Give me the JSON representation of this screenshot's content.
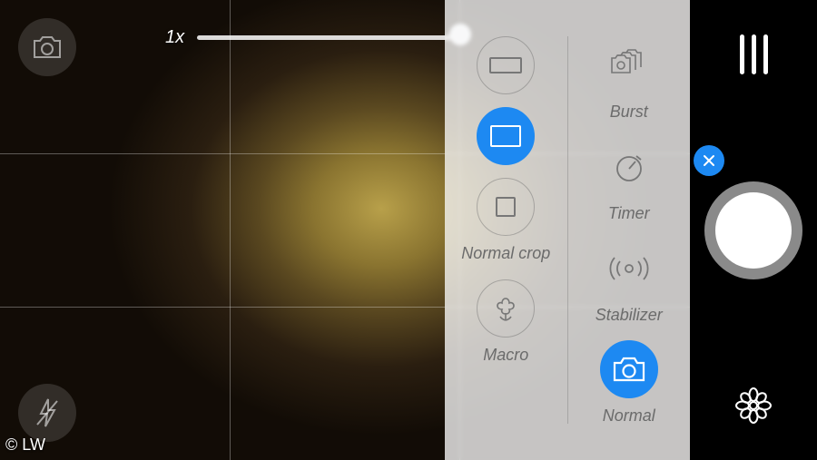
{
  "zoom": {
    "label": "1x"
  },
  "cropOptions": {
    "wide": "",
    "normal": "",
    "crop_label": "Normal crop",
    "macro_label": "Macro"
  },
  "modeOptions": {
    "burst": "Burst",
    "timer": "Timer",
    "stabilizer": "Stabilizer",
    "normal": "Normal"
  },
  "colors": {
    "accent": "#1d89f2"
  },
  "watermark": "© LW"
}
